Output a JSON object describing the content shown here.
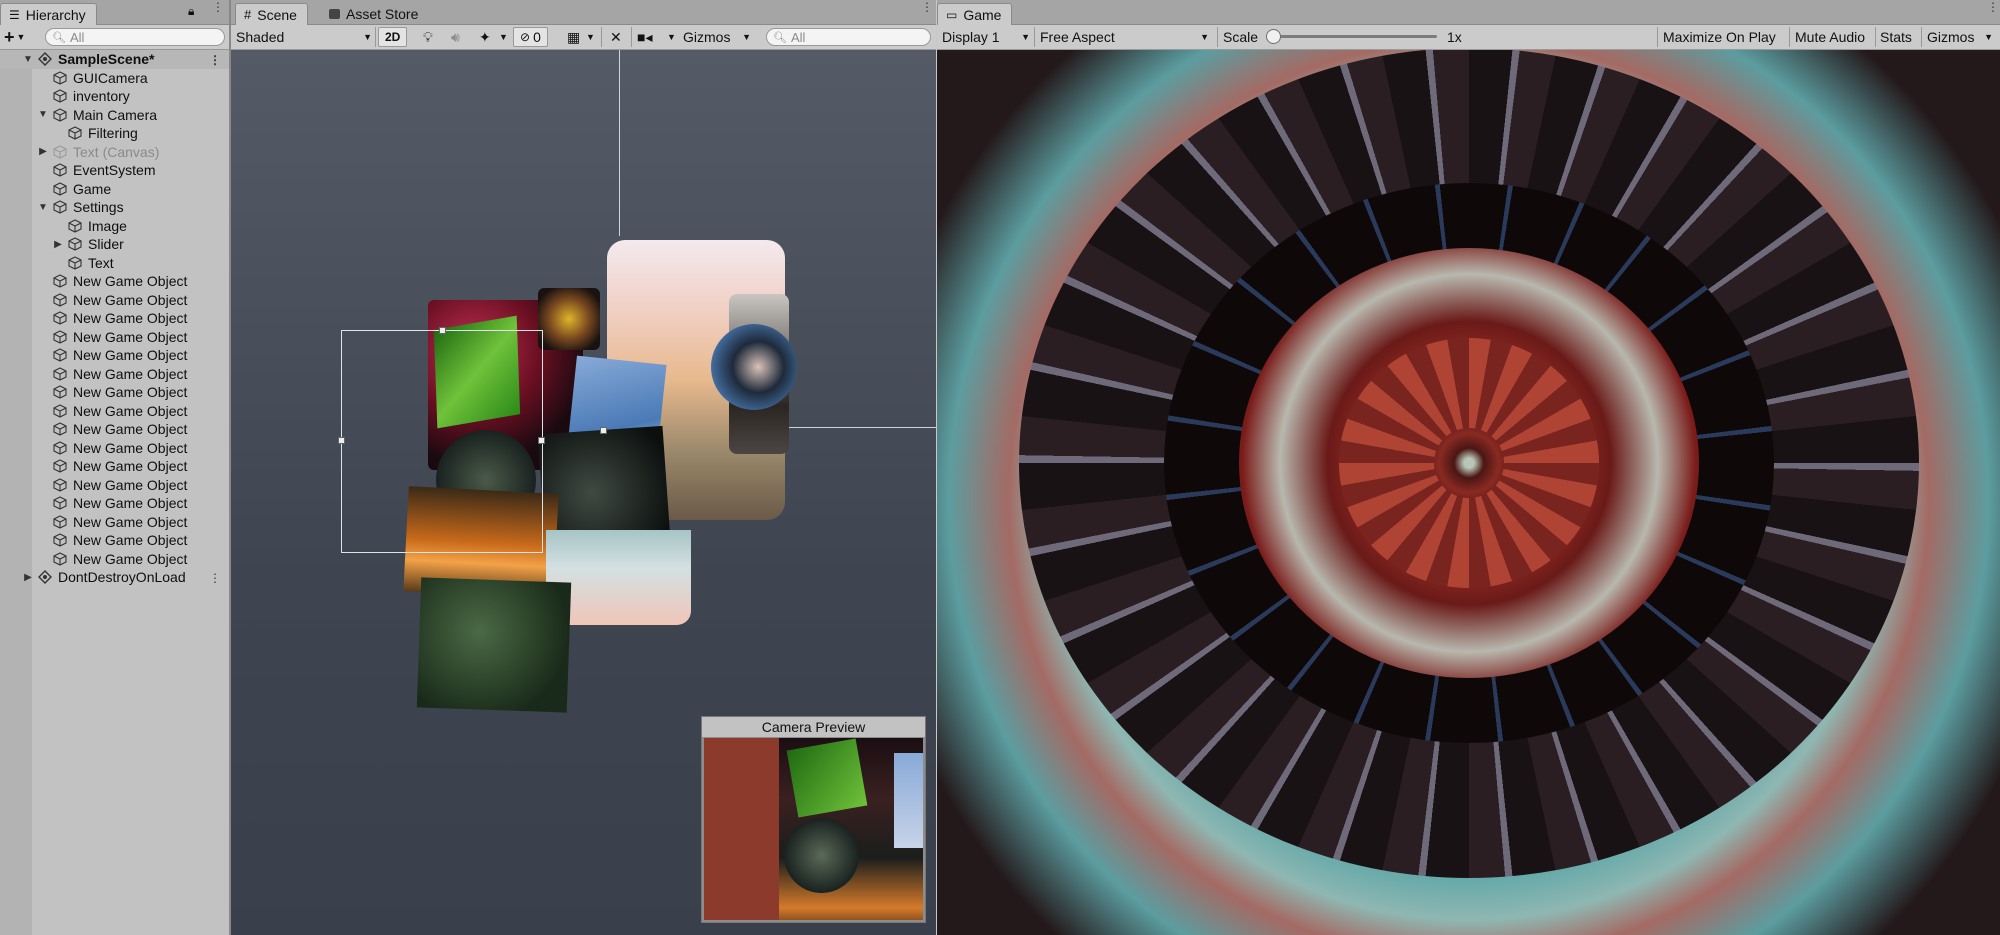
{
  "hierarchy": {
    "tab_label": "Hierarchy",
    "add_label": "+",
    "search_placeholder": "All",
    "items": [
      {
        "label": "SampleScene*",
        "depth": 0,
        "expanded": true,
        "scene": true
      },
      {
        "label": "GUICamera",
        "depth": 1
      },
      {
        "label": "inventory",
        "depth": 1
      },
      {
        "label": "Main Camera",
        "depth": 1,
        "expanded": true
      },
      {
        "label": "Filtering",
        "depth": 2
      },
      {
        "label": "Text (Canvas)",
        "depth": 1,
        "collapsed": true,
        "disabled": true
      },
      {
        "label": "EventSystem",
        "depth": 1
      },
      {
        "label": "Game",
        "depth": 1
      },
      {
        "label": "Settings",
        "depth": 1,
        "expanded": true
      },
      {
        "label": "Image",
        "depth": 2
      },
      {
        "label": "Slider",
        "depth": 2,
        "collapsed": true
      },
      {
        "label": "Text",
        "depth": 2
      },
      {
        "label": "New Game Object",
        "depth": 1
      },
      {
        "label": "New Game Object",
        "depth": 1
      },
      {
        "label": "New Game Object",
        "depth": 1
      },
      {
        "label": "New Game Object",
        "depth": 1
      },
      {
        "label": "New Game Object",
        "depth": 1
      },
      {
        "label": "New Game Object",
        "depth": 1
      },
      {
        "label": "New Game Object",
        "depth": 1
      },
      {
        "label": "New Game Object",
        "depth": 1
      },
      {
        "label": "New Game Object",
        "depth": 1
      },
      {
        "label": "New Game Object",
        "depth": 1
      },
      {
        "label": "New Game Object",
        "depth": 1
      },
      {
        "label": "New Game Object",
        "depth": 1
      },
      {
        "label": "New Game Object",
        "depth": 1
      },
      {
        "label": "New Game Object",
        "depth": 1
      },
      {
        "label": "New Game Object",
        "depth": 1
      },
      {
        "label": "New Game Object",
        "depth": 1
      },
      {
        "label": "DontDestroyOnLoad",
        "depth": 0,
        "collapsed": true,
        "scene": true,
        "plain": true
      }
    ]
  },
  "scene": {
    "tab_label": "Scene",
    "asset_store_label": "Asset Store",
    "shading_mode": "Shaded",
    "mode_2d": "2D",
    "hidden_count": "0",
    "gizmos_label": "Gizmos",
    "search_placeholder": "All",
    "camera_preview_title": "Camera Preview"
  },
  "game": {
    "tab_label": "Game",
    "display": "Display 1",
    "aspect": "Free Aspect",
    "scale_label": "Scale",
    "scale_value": "1x",
    "scale_level": 0,
    "maximize_label": "Maximize On Play",
    "mute_label": "Mute Audio",
    "stats_label": "Stats",
    "gizmos_label": "Gizmos"
  },
  "colors": {
    "scene_bg": "#3d4350",
    "kaleido_teal": "#5fa7a8",
    "kaleido_red": "#9a2f27",
    "kaleido_dark": "#1c1212",
    "preview_red": "#8c3a2c"
  }
}
